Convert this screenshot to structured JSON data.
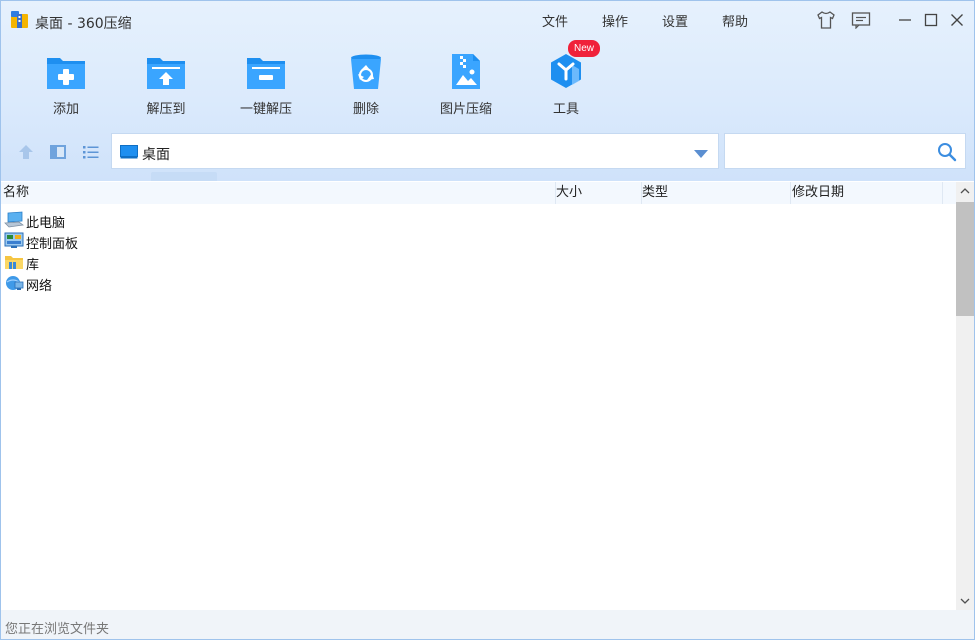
{
  "window": {
    "title": "桌面 - 360压缩"
  },
  "menu": {
    "file": "文件",
    "operate": "操作",
    "settings": "设置",
    "help": "帮助"
  },
  "title_icons": [
    "skin-icon",
    "feedback-icon",
    "minimize-icon",
    "maximize-icon",
    "close-icon"
  ],
  "toolbar": {
    "add": "添加",
    "extract_to": "解压到",
    "one_click_extract": "一键解压",
    "delete": "删除",
    "image_compress": "图片压缩",
    "tools": "工具",
    "new_badge": "New"
  },
  "nav": {
    "address": "桌面",
    "search_placeholder": ""
  },
  "columns": {
    "name": "名称",
    "size": "大小",
    "type": "类型",
    "modified": "修改日期"
  },
  "files": [
    {
      "name": "此电脑",
      "icon": "computer-icon"
    },
    {
      "name": "控制面板",
      "icon": "control-panel-icon"
    },
    {
      "name": "库",
      "icon": "library-folder-icon"
    },
    {
      "name": "网络",
      "icon": "network-icon"
    }
  ],
  "status": {
    "text": "您正在浏览文件夹"
  },
  "colors": {
    "accent": "#1e8ff0",
    "border": "#9fc3ec",
    "badge": "#f0213a"
  }
}
